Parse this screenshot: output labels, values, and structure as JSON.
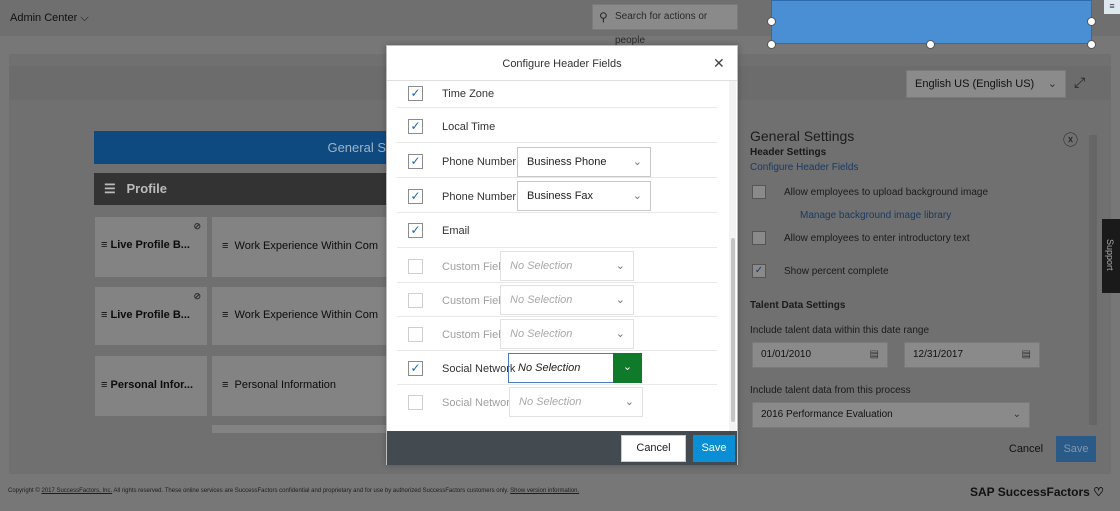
{
  "topbar": {
    "admin_center": "Admin Center",
    "admin_chevron": "⌵",
    "search_placeholder": "Search for actions or people"
  },
  "toolbar": {
    "language": "English US (English US)"
  },
  "left": {
    "general_bar": "General S",
    "profile_label": "Profile",
    "cards": [
      {
        "label": "Live Profile B..."
      },
      {
        "label": "Work Experience Within Com"
      },
      {
        "label": "Live Profile B..."
      },
      {
        "label": "Work Experience Within Com"
      },
      {
        "label": "Personal Infor..."
      },
      {
        "label": "Personal Information"
      }
    ]
  },
  "settings": {
    "title": "General Settings",
    "header_settings": "Header Settings",
    "configure_link": "Configure Header Fields",
    "upload_bg": "Allow employees to upload background image",
    "manage_bg": "Manage background image library",
    "intro_text": "Allow employees to enter introductory text",
    "percent_complete": "Show percent complete",
    "talent_title": "Talent Data Settings",
    "date_range_label": "Include talent data within this date range",
    "date_from": "01/01/2010",
    "date_to": "12/31/2017",
    "process_label": "Include talent data from this process",
    "process_value": "2016 Performance Evaluation",
    "cancel": "Cancel",
    "save": "Save"
  },
  "support": "Support",
  "footer": {
    "copyright_prefix": "Copyright ©",
    "copyright_link": "2017 SuccessFactors, Inc.",
    "copyright_rest": "All rights reserved. These online services are SuccessFactors confidential and proprietary and for use by authorized SuccessFactors customers only.",
    "version_link": "Show version information.",
    "logo": "SAP SuccessFactors"
  },
  "modal": {
    "title": "Configure Header Fields",
    "rows": [
      {
        "label": "Time Zone",
        "checked": true
      },
      {
        "label": "Local Time",
        "checked": true
      },
      {
        "label": "Phone Number 1",
        "checked": true,
        "select": "Business Phone"
      },
      {
        "label": "Phone Number 2",
        "checked": true,
        "select": "Business Fax"
      },
      {
        "label": "Email",
        "checked": true
      },
      {
        "label": "Custom Field",
        "checked": false,
        "select": "No Selection"
      },
      {
        "label": "Custom Field",
        "checked": false,
        "select": "No Selection"
      },
      {
        "label": "Custom Field",
        "checked": false,
        "select": "No Selection"
      },
      {
        "label": "Social Network",
        "checked": true,
        "select": "No Selection"
      },
      {
        "label": "Social Network",
        "checked": false,
        "select": "No Selection"
      }
    ],
    "cancel": "Cancel",
    "save": "Save"
  },
  "colors": {
    "primary_blue": "#0a8ed6",
    "highlight": "#f4f20a",
    "footer_dark": "#444b50"
  }
}
